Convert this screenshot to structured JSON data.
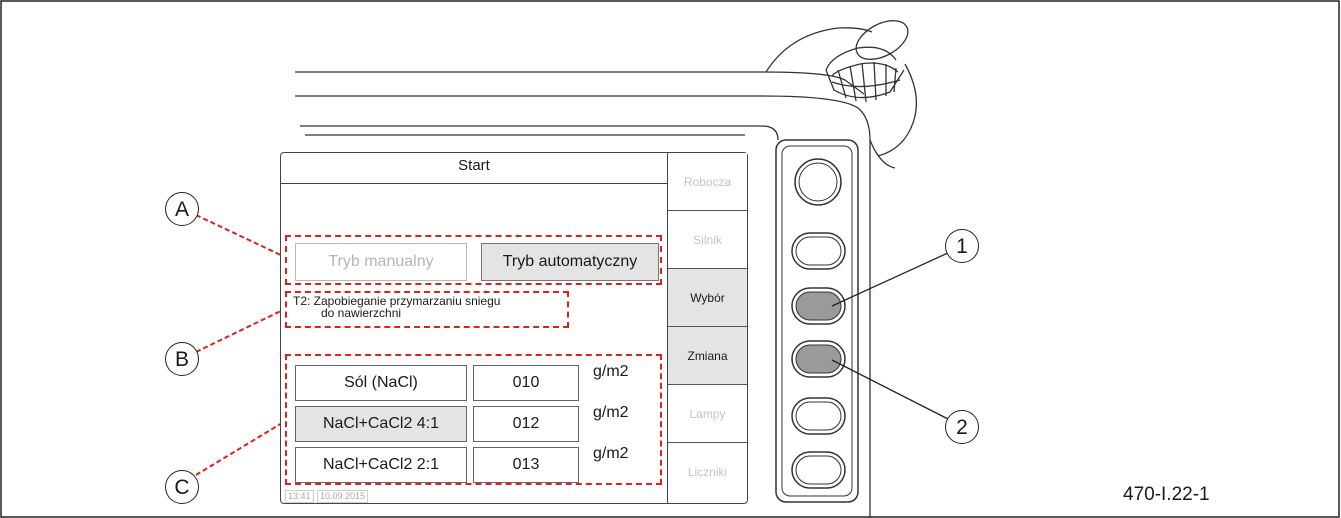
{
  "screen": {
    "title": "Start",
    "mode_buttons": [
      {
        "label": "Tryb manualny",
        "active": false
      },
      {
        "label": "Tryb automatyczny",
        "active": true
      }
    ],
    "program_line1": "T2: Zapobieganie przymarzaniu sniegu",
    "program_line2": "do nawierzchni",
    "materials": [
      {
        "name": "Sól (NaCl)",
        "value": "010",
        "unit": "g/m2",
        "selected": false
      },
      {
        "name": "NaCl+CaCl2 4:1",
        "value": "012",
        "unit": "g/m2",
        "selected": true
      },
      {
        "name": "NaCl+CaCl2 2:1",
        "value": "013",
        "unit": "g/m2",
        "selected": false
      }
    ],
    "side_tabs": [
      {
        "label": "Robocza",
        "active": false
      },
      {
        "label": "Silnik",
        "active": false
      },
      {
        "label": "Wybór",
        "active": true
      },
      {
        "label": "Zmiana",
        "active": true
      },
      {
        "label": "Lampy",
        "active": false
      },
      {
        "label": "Liczniki",
        "active": false
      }
    ],
    "status_time": "13:41",
    "status_date": "10.09.2015"
  },
  "callouts": {
    "a": "A",
    "b": "B",
    "c": "C",
    "one": "1",
    "two": "2"
  },
  "figure_code": "470-I.22-1",
  "colors": {
    "dash": "#e0201b",
    "highlight": "#e4e4e4",
    "pressed_button": "#9a9a9a"
  }
}
